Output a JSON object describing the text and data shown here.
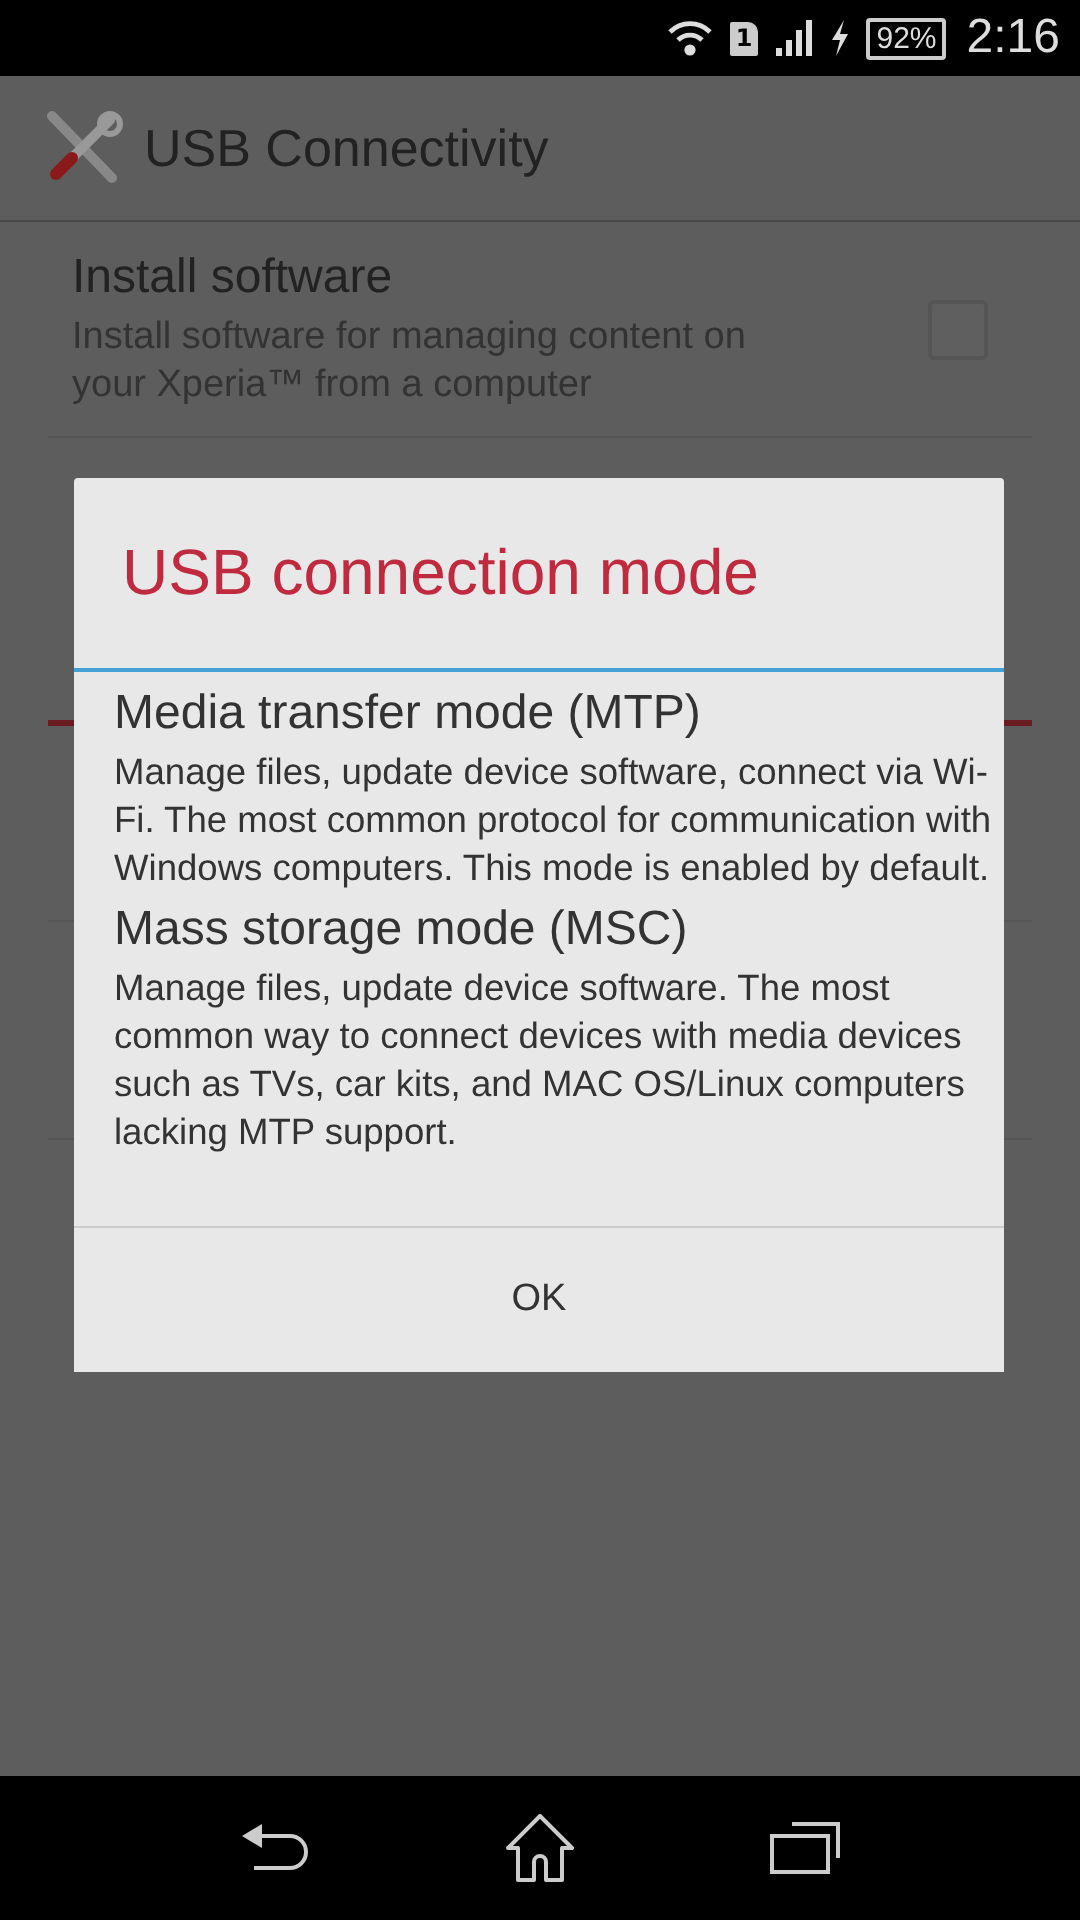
{
  "status_bar": {
    "sim_slot": "1",
    "battery": "92%",
    "time": "2:16"
  },
  "app_bar": {
    "title": "USB Connectivity"
  },
  "settings": [
    {
      "title": "Install software",
      "description": "Install software for managing content on your Xperia™ from a computer",
      "checked": false
    }
  ],
  "dialog": {
    "title": "USB connection mode",
    "options": [
      {
        "title": "Media transfer mode (MTP)",
        "description": "Manage files, update device software, connect via Wi-Fi. The most common protocol for communication with Windows computers. This mode is enabled by default."
      },
      {
        "title": "Mass storage mode (MSC)",
        "description": "Manage files, update device software. The most common way to connect devices with media devices such as TVs, car kits, and MAC OS/Linux computers lacking MTP support."
      }
    ],
    "buttons": [
      "OK"
    ]
  }
}
